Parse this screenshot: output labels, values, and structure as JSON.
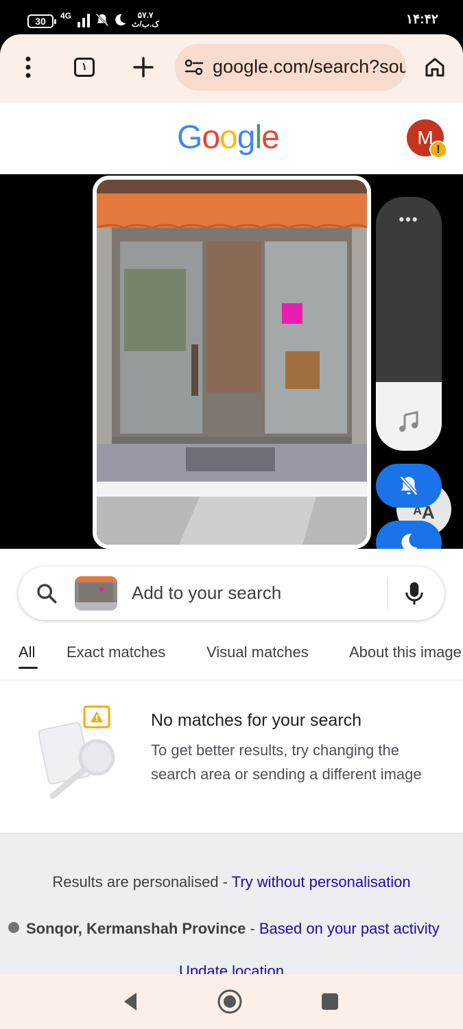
{
  "status_bar": {
    "battery": "30",
    "network": "4G",
    "speed_value": "۵۷.۷",
    "speed_unit": "ک.ب/ث",
    "time": "۱۴:۴۲"
  },
  "browser": {
    "tab_count": "۱",
    "url": "google.com/search?sou"
  },
  "google": {
    "logo": [
      "G",
      "o",
      "o",
      "g",
      "l",
      "e"
    ],
    "logo_colors": [
      "#4285F4",
      "#EA4335",
      "#FBBC05",
      "#4285F4",
      "#34A853",
      "#EA4335"
    ],
    "avatar_initial": "M",
    "avatar_badge": "!"
  },
  "search": {
    "placeholder": "Add to your search",
    "tabs": [
      {
        "label": "All",
        "active": true
      },
      {
        "label": "Exact matches"
      },
      {
        "label": "Visual matches"
      },
      {
        "label": "About this image"
      }
    ]
  },
  "results": {
    "title": "No matches for your search",
    "body": "To get better results, try changing the search area or sending a different image"
  },
  "footer": {
    "personalised_text": "Results are personalised",
    "personalised_sep": " - ",
    "personalised_link": "Try without personalisation",
    "location": "Sonqor, Kermanshah Province",
    "location_sep": " - ",
    "location_link": "Based on your past activity",
    "update_location": "Update location"
  },
  "colors": {
    "accent": "#1a73e8",
    "link": "#1a0dab",
    "toolbar_bg": "#fbefe8",
    "urlbar_bg": "#f7dccf"
  }
}
